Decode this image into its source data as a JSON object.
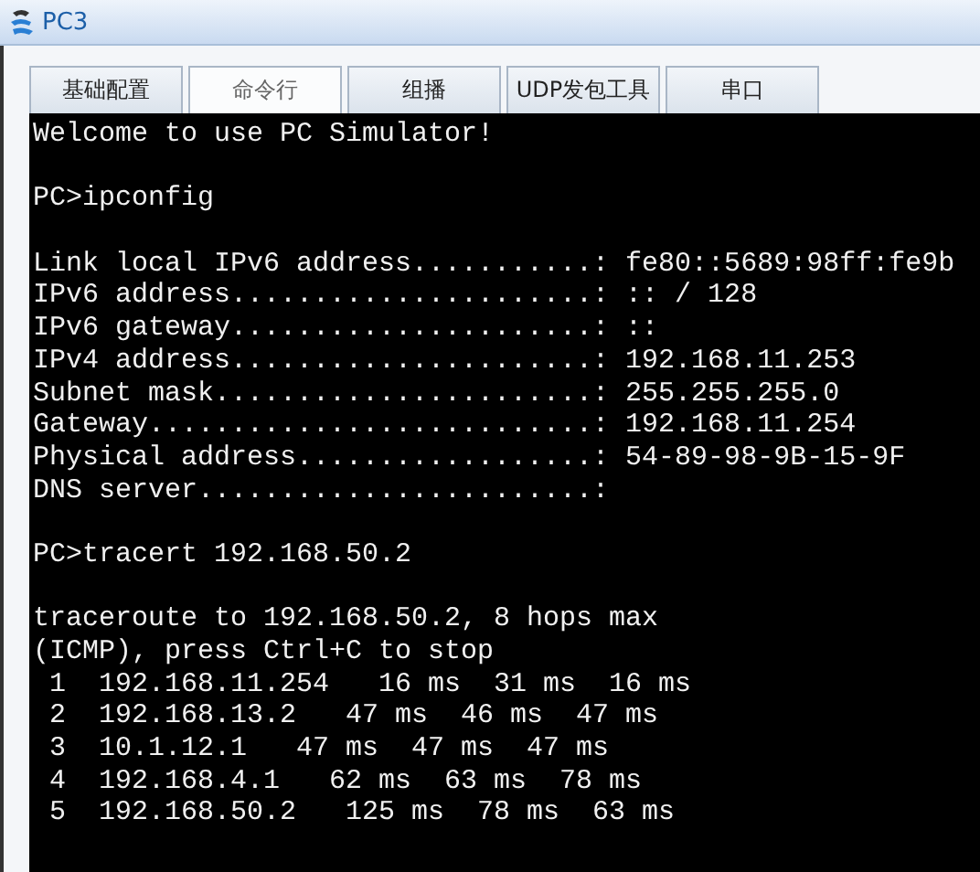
{
  "window": {
    "title": "PC3"
  },
  "tabs": [
    {
      "label": "基础配置",
      "selected": false
    },
    {
      "label": "命令行",
      "selected": true
    },
    {
      "label": "组播",
      "selected": false
    },
    {
      "label": "UDP发包工具",
      "selected": false
    },
    {
      "label": "串口",
      "selected": false
    }
  ],
  "terminal": {
    "blocks": [
      [
        "Welcome to use PC Simulator!"
      ],
      [
        "PC>ipconfig"
      ],
      [
        "Link local IPv6 address...........: fe80::5689:98ff:fe9b",
        "IPv6 address......................: :: / 128",
        "IPv6 gateway......................: ::",
        "IPv4 address......................: 192.168.11.253",
        "Subnet mask.......................: 255.255.255.0",
        "Gateway...........................: 192.168.11.254",
        "Physical address..................: 54-89-98-9B-15-9F",
        "DNS server........................:"
      ],
      [
        "PC>tracert 192.168.50.2"
      ],
      [
        "traceroute to 192.168.50.2, 8 hops max",
        "(ICMP), press Ctrl+C to stop",
        " 1  192.168.11.254   16 ms  31 ms  16 ms",
        " 2  192.168.13.2   47 ms  46 ms  47 ms",
        " 3  10.1.12.1   47 ms  47 ms  47 ms",
        " 4  192.168.4.1   62 ms  63 ms  78 ms",
        " 5  192.168.50.2   125 ms  78 ms  63 ms"
      ]
    ]
  }
}
